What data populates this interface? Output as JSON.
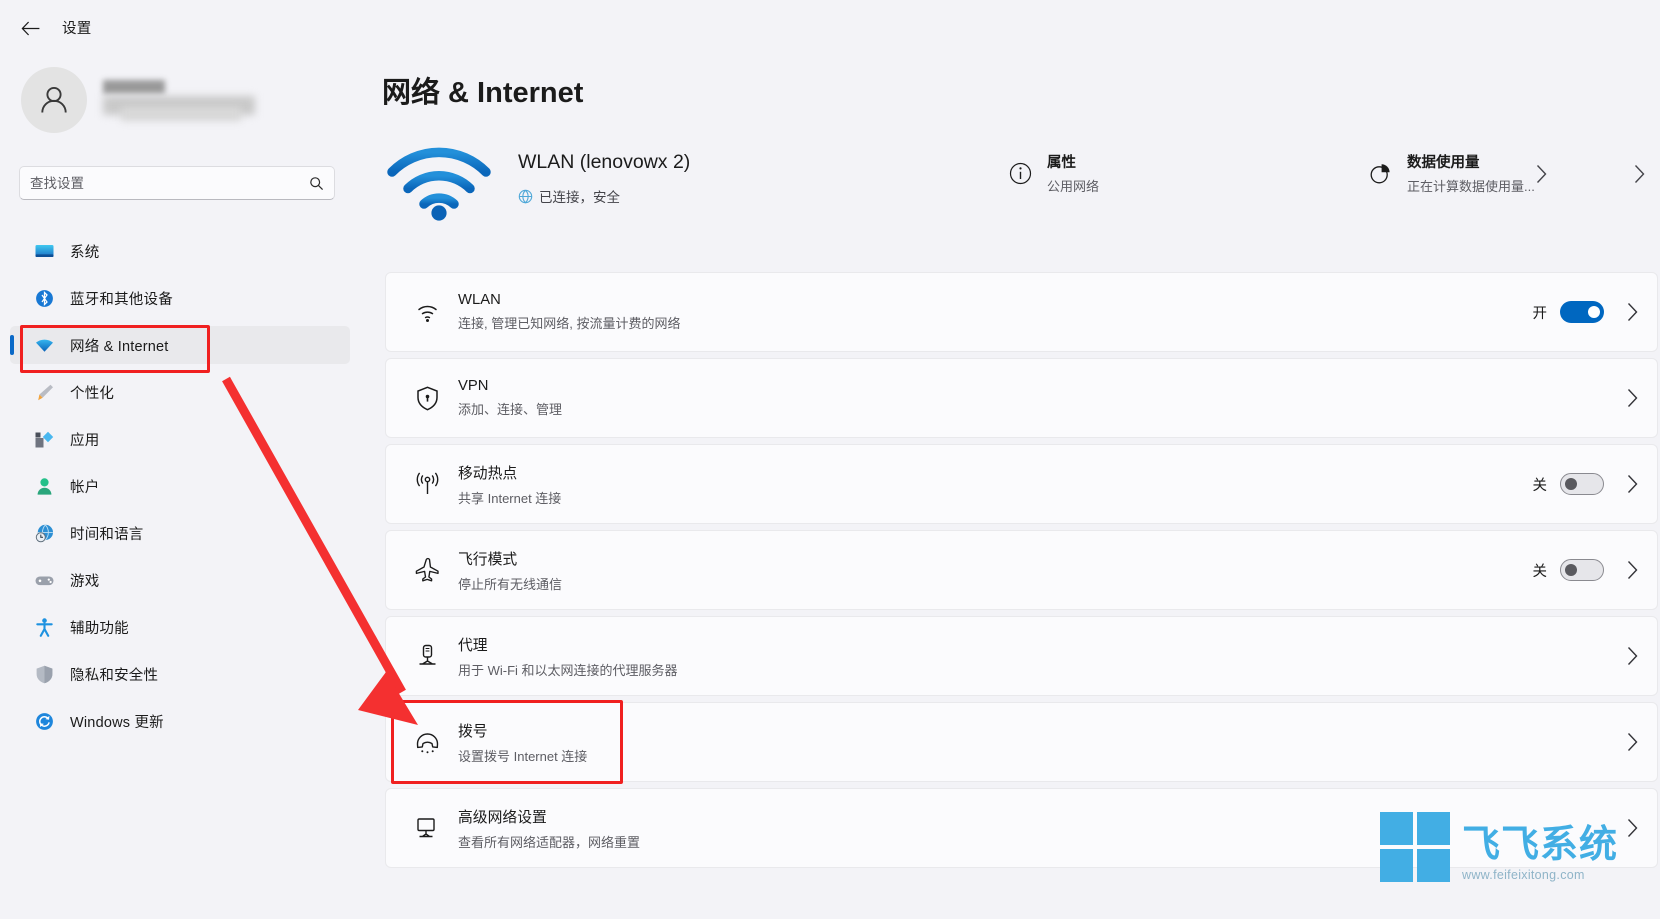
{
  "window": {
    "back_label": "返回",
    "title": "设置"
  },
  "sidebar": {
    "profile": {
      "avatar_icon": "person-icon"
    },
    "search": {
      "placeholder": "查找设置",
      "value": "",
      "icon": "search-icon"
    },
    "items": [
      {
        "label": "系统",
        "icon": "monitor-icon",
        "selected": false
      },
      {
        "label": "蓝牙和其他设备",
        "icon": "bluetooth-icon",
        "selected": false
      },
      {
        "label": "网络 & Internet",
        "icon": "wifi-icon",
        "selected": true
      },
      {
        "label": "个性化",
        "icon": "brush-icon",
        "selected": false
      },
      {
        "label": "应用",
        "icon": "apps-icon",
        "selected": false
      },
      {
        "label": "帐户",
        "icon": "account-icon",
        "selected": false
      },
      {
        "label": "时间和语言",
        "icon": "clock-globe-icon",
        "selected": false
      },
      {
        "label": "游戏",
        "icon": "gamepad-icon",
        "selected": false
      },
      {
        "label": "辅助功能",
        "icon": "accessibility-icon",
        "selected": false
      },
      {
        "label": "隐私和安全性",
        "icon": "shield-icon",
        "selected": false
      },
      {
        "label": "Windows 更新",
        "icon": "update-icon",
        "selected": false
      }
    ]
  },
  "main": {
    "page_title": "网络 & Internet",
    "network_summary": {
      "icon": "wifi-large-icon",
      "name": "WLAN (lenovowx 2)",
      "status_icon": "globe-icon",
      "status": "已连接，安全"
    },
    "quick_actions": [
      {
        "icon": "info-icon",
        "title": "属性",
        "subtitle": "公用网络",
        "chevron": "chevron-right-icon"
      },
      {
        "icon": "pie-chart-icon",
        "title": "数据使用量",
        "subtitle": "正在计算数据使用量...",
        "chevron": "chevron-right-icon"
      }
    ],
    "settings_rows": [
      {
        "icon": "wifi-icon",
        "title": "WLAN",
        "subtitle": "连接, 管理已知网络, 按流量计费的网络",
        "toggle": {
          "state": "on",
          "label": "开"
        },
        "chevron": "chevron-right-icon"
      },
      {
        "icon": "shield-lock-icon",
        "title": "VPN",
        "subtitle": "添加、连接、管理",
        "toggle": null,
        "chevron": "chevron-right-icon"
      },
      {
        "icon": "hotspot-icon",
        "title": "移动热点",
        "subtitle": "共享 Internet 连接",
        "toggle": {
          "state": "off",
          "label": "关"
        },
        "chevron": "chevron-right-icon"
      },
      {
        "icon": "airplane-icon",
        "title": "飞行模式",
        "subtitle": "停止所有无线通信",
        "toggle": {
          "state": "off",
          "label": "关"
        },
        "chevron": "chevron-right-icon"
      },
      {
        "icon": "proxy-icon",
        "title": "代理",
        "subtitle": "用于 Wi-Fi 和以太网连接的代理服务器",
        "toggle": null,
        "chevron": "chevron-right-icon"
      },
      {
        "icon": "dialup-icon",
        "title": "拨号",
        "subtitle": "设置拨号 Internet 连接",
        "toggle": null,
        "chevron": "chevron-right-icon"
      },
      {
        "icon": "advanced-network-icon",
        "title": "高级网络设置",
        "subtitle": "查看所有网络适配器，网络重置",
        "toggle": null,
        "chevron": "chevron-right-icon"
      }
    ]
  },
  "annotations": {
    "color": "#f02020",
    "highlight_sidebar_item": "网络 & Internet",
    "highlight_row": "拨号",
    "arrow": "red-arrow"
  },
  "watermark": {
    "brand": "飞飞系统",
    "url": "www.feifeixitong.com",
    "color": "#42aee4",
    "logo_icon": "windows-logo-icon"
  },
  "colors": {
    "accent": "#0067c0",
    "selection_indicator": "#0b69c7",
    "page_bg": "#f3f3f7",
    "card_bg": "#fbfbfd",
    "annotation": "#f02020"
  }
}
